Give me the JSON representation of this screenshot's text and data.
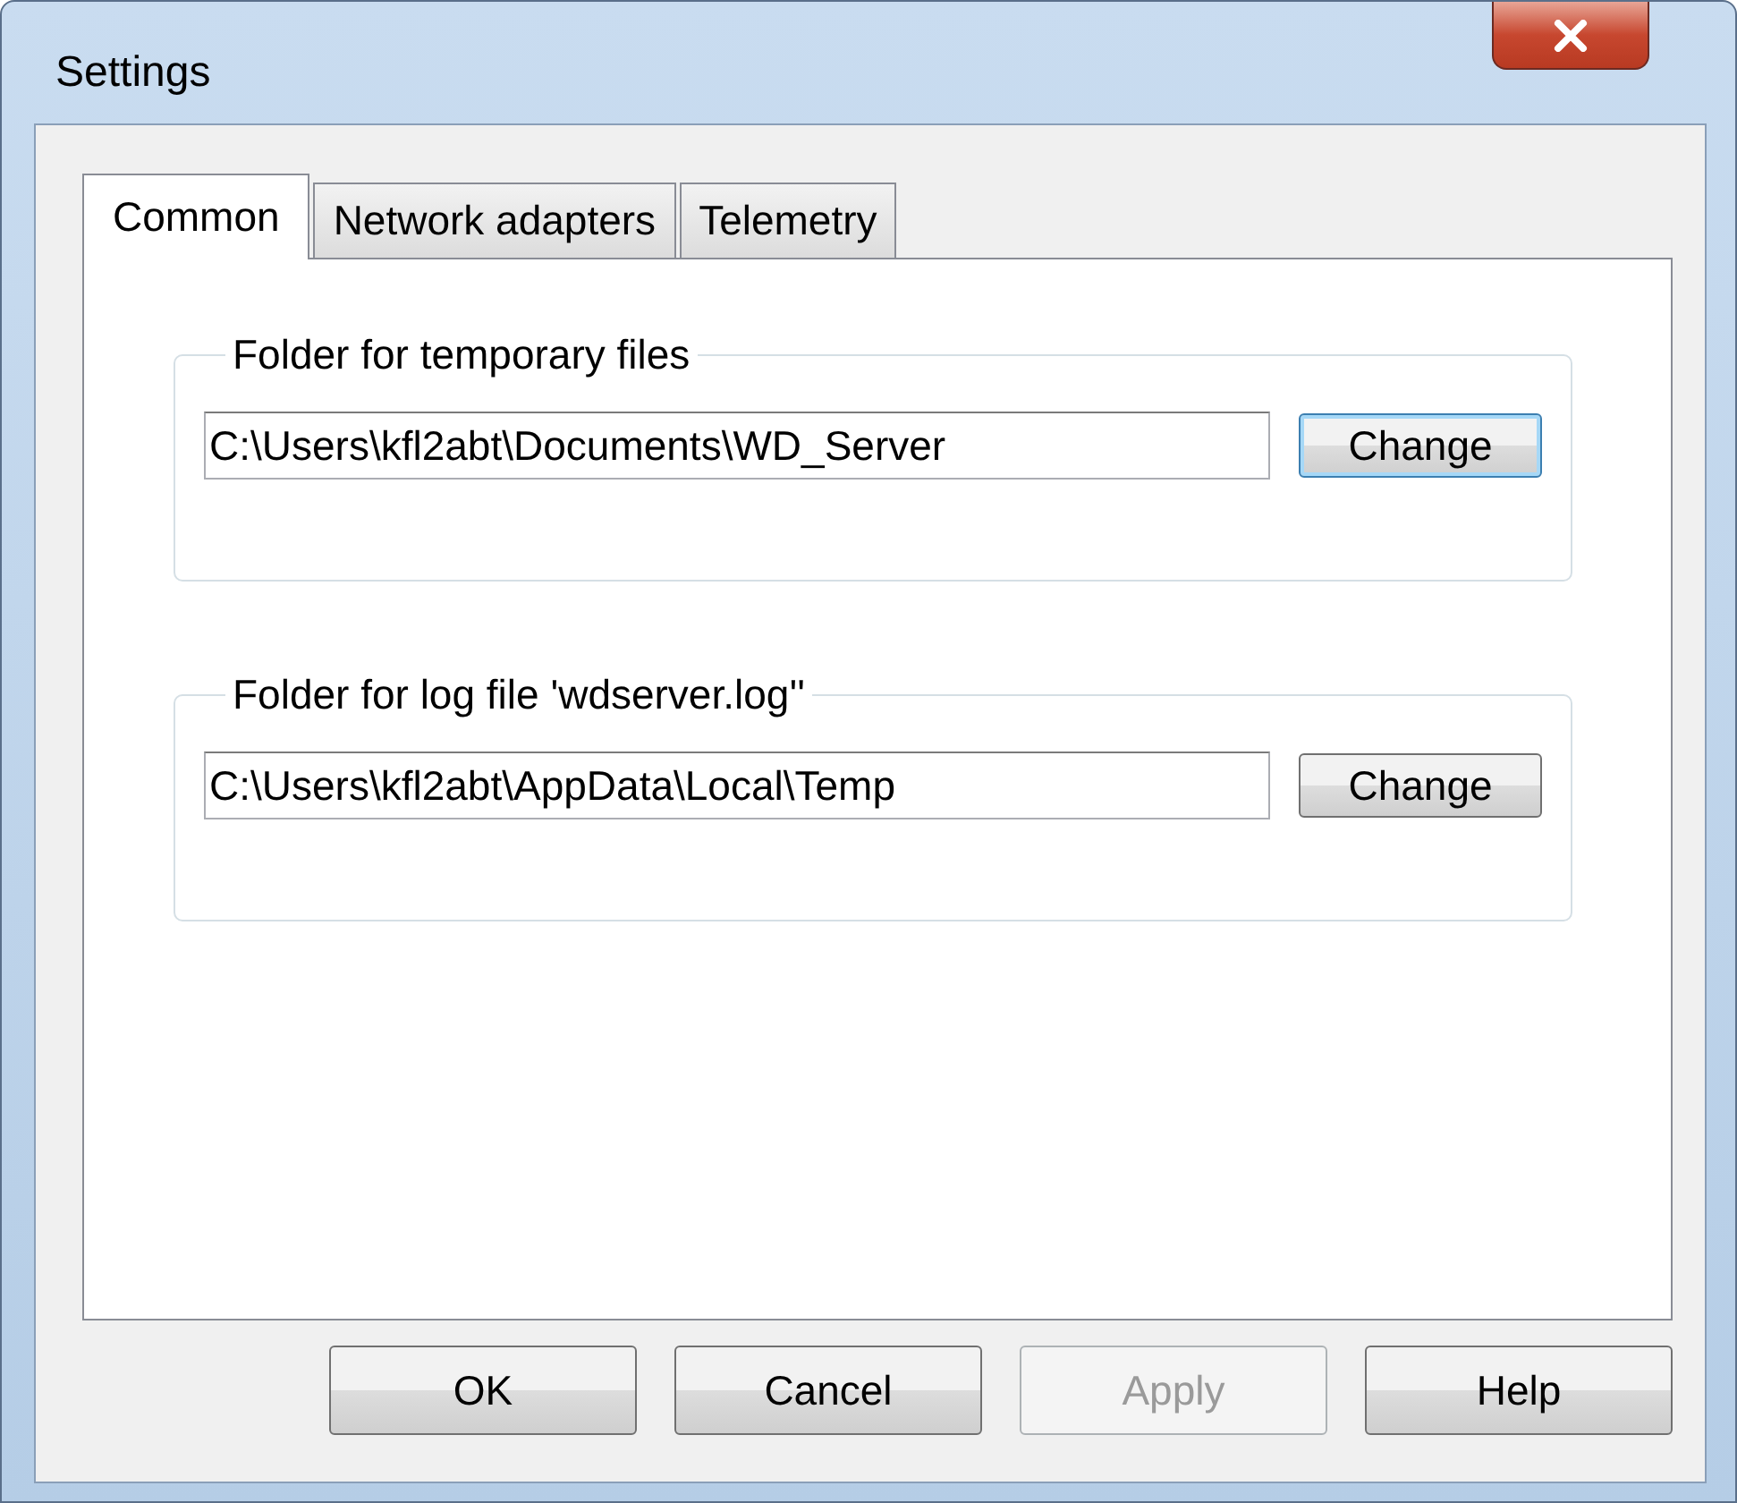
{
  "window": {
    "title": "Settings"
  },
  "tabs": [
    {
      "label": "Common",
      "selected": true
    },
    {
      "label": "Network adapters",
      "selected": false
    },
    {
      "label": "Telemetry",
      "selected": false
    }
  ],
  "groups": [
    {
      "legend": "Folder for temporary files",
      "path": "C:\\Users\\kfl2abt\\Documents\\WD_Server",
      "button": {
        "label": "Change",
        "focused": true
      }
    },
    {
      "legend": "Folder for log file 'wdserver.log''",
      "path": "C:\\Users\\kfl2abt\\AppData\\Local\\Temp",
      "button": {
        "label": "Change",
        "focused": false
      }
    }
  ],
  "buttons": [
    {
      "label": "OK",
      "disabled": false
    },
    {
      "label": "Cancel",
      "disabled": false
    },
    {
      "label": "Apply",
      "disabled": true
    },
    {
      "label": "Help",
      "disabled": false
    }
  ]
}
